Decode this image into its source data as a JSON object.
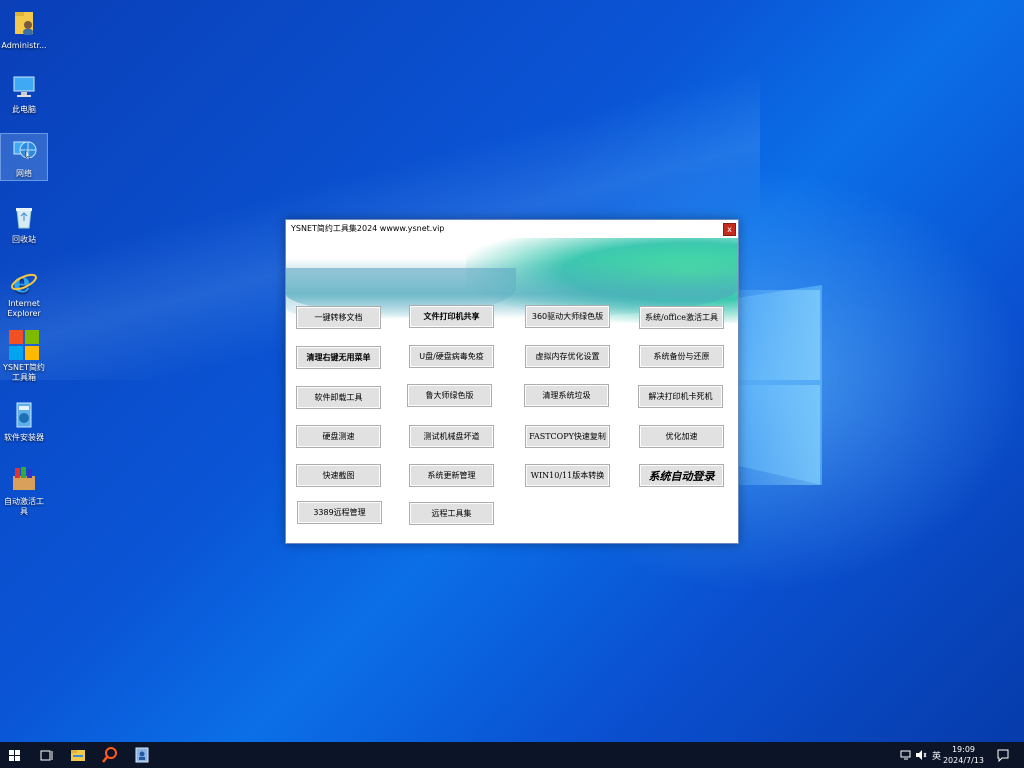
{
  "desktop": {
    "icons": [
      {
        "label": "Administr...",
        "icon": "user-folder-icon"
      },
      {
        "label": "此电脑",
        "icon": "computer-icon"
      },
      {
        "label": "网络",
        "icon": "network-icon"
      },
      {
        "label": "回收站",
        "icon": "recycle-bin-icon"
      },
      {
        "label": "Internet Explorer",
        "icon": "ie-icon"
      },
      {
        "label": "YSNET简约工具箱",
        "icon": "toolbox-icon"
      },
      {
        "label": "软件安装器",
        "icon": "installer-icon"
      },
      {
        "label": "自动激活工具",
        "icon": "activation-icon"
      }
    ]
  },
  "window": {
    "title": "YSNET简约工具集2024 wwww.ysnet.vip",
    "close_label": "x",
    "buttons": [
      "一键转移文档",
      "文件打印机共享",
      "360驱动大师绿色版",
      "系统/office激活工具",
      "清理右键无用菜单",
      "U盘/硬盘病毒免疫",
      "虚拟内存优化设置",
      "系统备份与还原",
      "软件卸载工具",
      "鲁大师绿色版",
      "清理系统垃圾",
      "解决打印机卡死机",
      "硬盘测速",
      "测试机械盘坏道",
      "FASTCOPY快速复制",
      "优化加速",
      "快速截图",
      "系统更新管理",
      "WIN10/11版本转换",
      "系统自动登录",
      "3389远程管理",
      "远程工具集"
    ]
  },
  "taskbar": {
    "items": [
      "start-icon",
      "task-view-icon",
      "file-explorer-icon",
      "search-icon",
      "app-icon"
    ],
    "ime": "英",
    "time": "19:09",
    "date": "2024/7/13"
  },
  "colors": {
    "accent": "#0a55d6",
    "close": "#c42b1c",
    "taskbar": "#0c1427"
  }
}
